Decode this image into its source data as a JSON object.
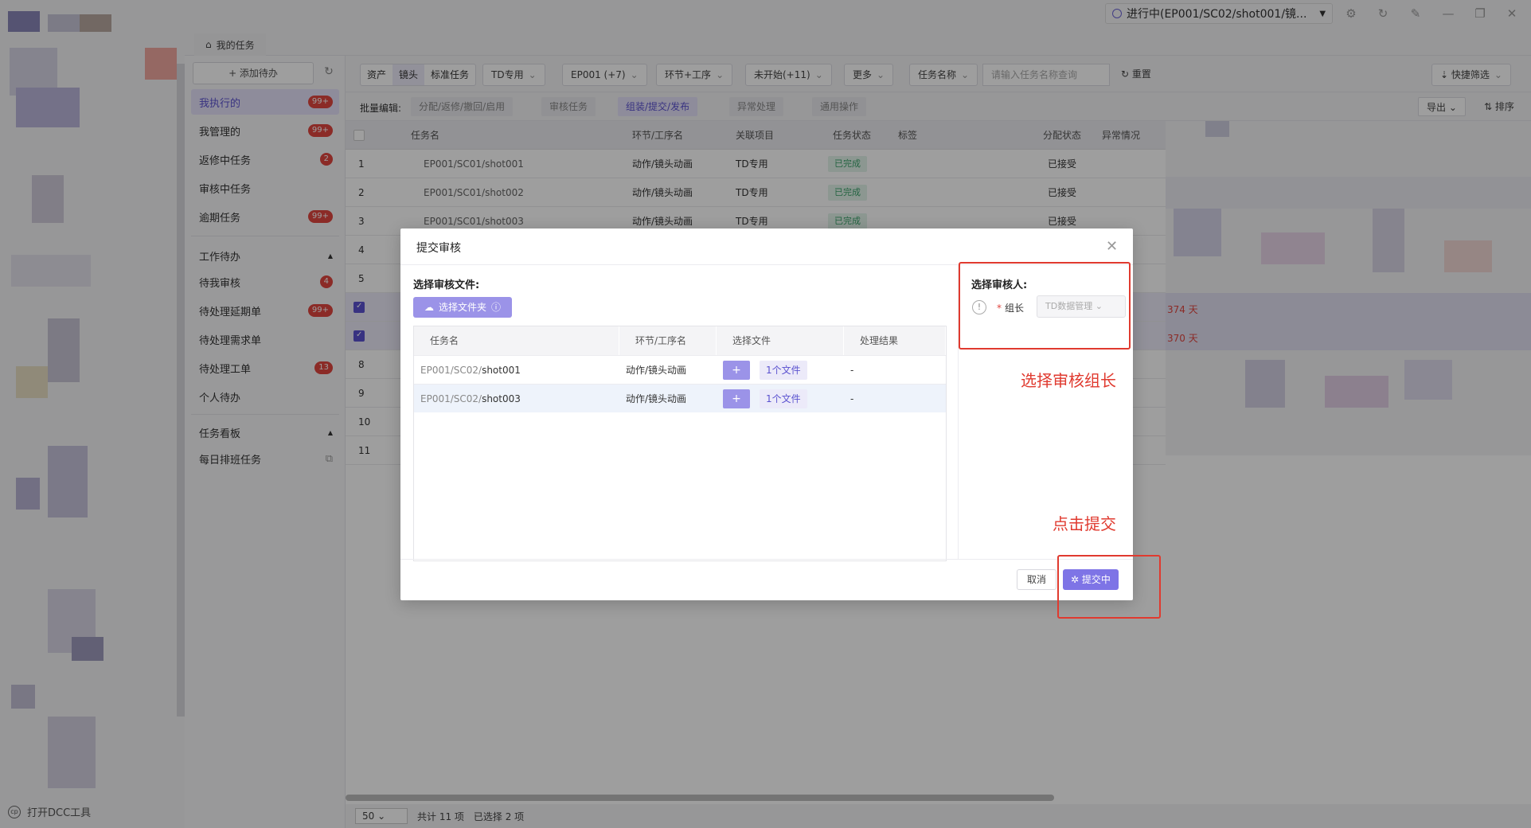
{
  "status": {
    "label": "进行中(EP001/SC02/shot001/镜..."
  },
  "tabs": {
    "home": "我的任务"
  },
  "sidebar": {
    "add_button": "+ 添加待办",
    "items": [
      {
        "label": "我执行的",
        "badge": "99+"
      },
      {
        "label": "我管理的",
        "badge": "99+"
      },
      {
        "label": "返修中任务",
        "badge": "2"
      },
      {
        "label": "审核中任务",
        "badge": ""
      },
      {
        "label": "逾期任务",
        "badge": "99+"
      }
    ],
    "group1": {
      "label": "工作待办"
    },
    "group1_items": [
      {
        "label": "待我审核",
        "badge": "4"
      },
      {
        "label": "待处理延期单",
        "badge": "99+"
      },
      {
        "label": "待处理需求单",
        "badge": ""
      },
      {
        "label": "待处理工单",
        "badge": "13"
      },
      {
        "label": "个人待办",
        "badge": ""
      }
    ],
    "group2": {
      "label": "任务看板"
    },
    "group2_items": [
      {
        "label": "每日排班任务"
      }
    ],
    "dcc_tool": "打开DCC工具"
  },
  "toolbar": {
    "seg": [
      "资产",
      "镜头",
      "标准任务"
    ],
    "filters": [
      "TD专用",
      "EP001 (+7)",
      "环节+工序",
      "未开始(+11)",
      "更多"
    ],
    "search_field": "任务名称",
    "search_placeholder": "请输入任务名称查询",
    "reset": "重置",
    "quick_filter": "快捷筛选"
  },
  "batchbar": {
    "label": "批量编辑:",
    "items": [
      "分配/返修/撤回/启用",
      "审核任务",
      "组装/提交/发布",
      "异常处理",
      "通用操作"
    ],
    "export": "导出",
    "sort": "排序"
  },
  "table": {
    "headers": [
      "任务名",
      "环节/工序名",
      "关联项目",
      "任务状态",
      "标签",
      "分配状态",
      "异常情况"
    ],
    "rows": [
      {
        "no": "1",
        "task": "EP001/SC01/shot001",
        "step": "动作/镜头动画",
        "proj": "TD专用",
        "status": "已完成",
        "assign": "已接受"
      },
      {
        "no": "2",
        "task": "EP001/SC01/shot002",
        "step": "动作/镜头动画",
        "proj": "TD专用",
        "status": "已完成",
        "assign": "已接受"
      },
      {
        "no": "3",
        "task": "EP001/SC01/shot003",
        "step": "动作/镜头动画",
        "proj": "TD专用",
        "status": "已完成",
        "assign": "已接受"
      },
      {
        "no": "4"
      },
      {
        "no": "5"
      },
      {
        "no": ""
      },
      {
        "no": ""
      },
      {
        "no": "8"
      },
      {
        "no": "9"
      },
      {
        "no": "10"
      },
      {
        "no": "11"
      }
    ],
    "overdue1": "374 天",
    "overdue2": "370 天"
  },
  "pager": {
    "page_size": "50",
    "total": "共计 11 项",
    "selected": "已选择 2 项"
  },
  "modal": {
    "title": "提交审核",
    "files_label": "选择审核文件:",
    "pick_folder": "选择文件夹",
    "file_headers": [
      "任务名",
      "环节/工序名",
      "选择文件",
      "处理结果"
    ],
    "files": [
      {
        "prefix": "EP001/SC02/",
        "name": "shot001",
        "step": "动作/镜头动画",
        "file": "1个文件",
        "result": "-"
      },
      {
        "prefix": "EP001/SC02/",
        "name": "shot003",
        "step": "动作/镜头动画",
        "file": "1个文件",
        "result": "-"
      }
    ],
    "reviewer_label": "选择审核人:",
    "leader_label": "组长",
    "leader_value": "TD数据管理",
    "cancel": "取消",
    "submit": "提交中"
  },
  "annotations": {
    "choose_leader": "选择审核组长",
    "click_submit": "点击提交"
  }
}
